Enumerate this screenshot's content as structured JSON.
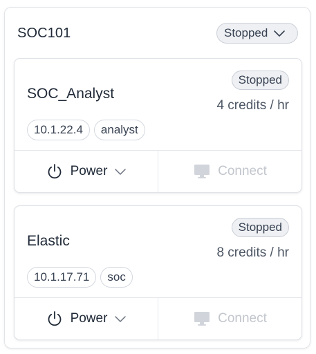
{
  "group": {
    "title": "SOC101",
    "status_label": "Stopped"
  },
  "cards": [
    {
      "name": "SOC_Analyst",
      "status": "Stopped",
      "credits": "4 credits / hr",
      "tags": [
        "10.1.22.4",
        "analyst"
      ],
      "power_label": "Power",
      "connect_label": "Connect"
    },
    {
      "name": "Elastic",
      "status": "Stopped",
      "credits": "8 credits / hr",
      "tags": [
        "10.1.17.71",
        "soc"
      ],
      "power_label": "Power",
      "connect_label": "Connect"
    }
  ],
  "icons": {
    "status_dropdown": "chevron-down-icon",
    "power": "power-icon",
    "power_menu": "chevron-down-icon",
    "connect": "monitor-icon"
  },
  "colors": {
    "disabled_text": "#c2c6cd",
    "badge_bg": "#eef0f3"
  }
}
